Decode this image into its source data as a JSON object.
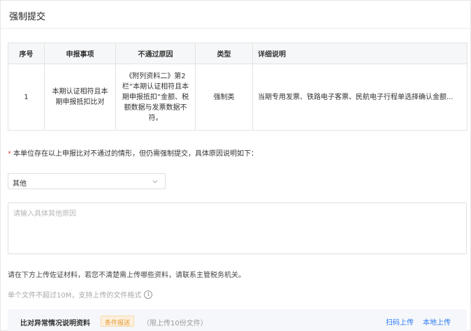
{
  "dialog": {
    "title": "强制提交"
  },
  "table": {
    "headers": [
      "序号",
      "申报事项",
      "不通过原因",
      "类型",
      "详细说明"
    ],
    "rows": [
      {
        "index": "1",
        "item": "本期认证相符且本期申报抵扣比对",
        "reason": "《附列资料二》第2栏“本期认证相符且本期申报抵扣”金额、税额数据与发票数据不符。",
        "type": "强制类",
        "detail": "当期专用发票、铁路电子客票、民航电子行程单选择确认金额..."
      }
    ]
  },
  "form": {
    "required_mark": "*",
    "reason_label": "本单位存在以上申报比对不通过的情形，但仍需强制提交，具体原因说明如下：",
    "select_value": "其他",
    "textarea_placeholder": "请输入具体其他原因"
  },
  "upload": {
    "hint": "请在下方上传佐证材料，若您不清楚需上传哪些资料，请联系主管税务机关。",
    "size_hint": "单个文件不超过10M，支持上传的文件格式",
    "attachment_name": "比对异常情况说明资料",
    "tag": "条件报送",
    "limit": "（限上传10份文件）",
    "scan_label": "扫码上传",
    "local_label": "本地上传"
  }
}
